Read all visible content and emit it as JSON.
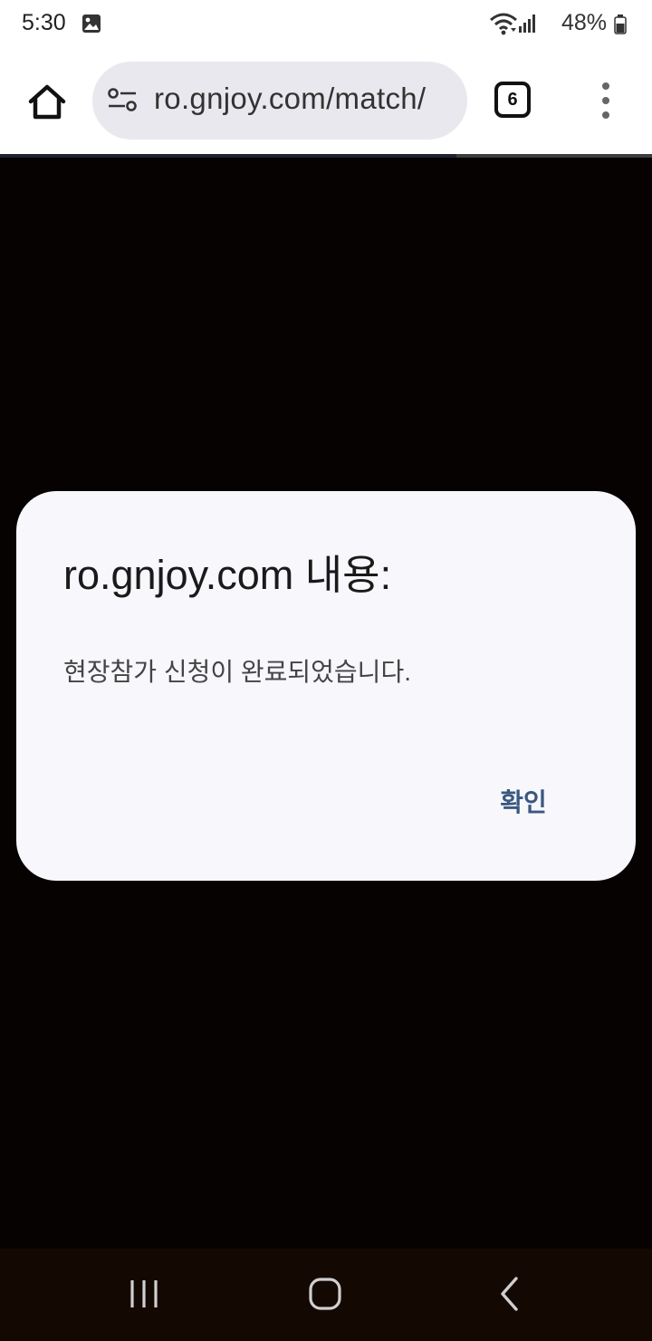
{
  "status_bar": {
    "time": "5:30",
    "battery": "48%",
    "icons": [
      "gallery-icon",
      "wifi-icon",
      "signal-icon",
      "battery-icon"
    ]
  },
  "browser": {
    "url": "ro.gnjoy.com/match/",
    "tab_count": "6",
    "page_load_progress": 0.7,
    "icons": [
      "home-icon",
      "site-settings-icon",
      "tabs-icon",
      "more-vert-icon"
    ]
  },
  "dialog": {
    "title": "ro.gnjoy.com 내용:",
    "message": "현장참가 신청이 완료되었습니다.",
    "ok_label": "확인"
  },
  "nav_bar": {
    "icons": [
      "recents-icon",
      "home-icon",
      "back-icon"
    ]
  },
  "colors": {
    "page_background": "#060202",
    "dialog_background": "#f7f7fc",
    "accent": "#3a5880",
    "nav_background": "#140803"
  }
}
